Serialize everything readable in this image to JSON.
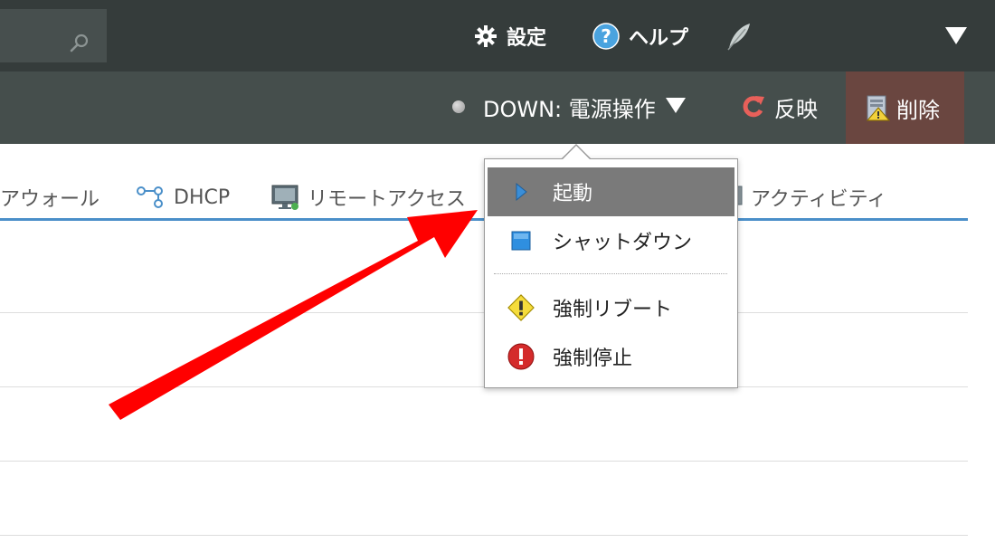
{
  "header": {
    "settings_label": "設定",
    "help_label": "ヘルプ"
  },
  "actions": {
    "power_status": "DOWN: 電源操作",
    "reflect_label": "反映",
    "delete_label": "削除"
  },
  "tabs": [
    {
      "label": "アウォール",
      "icon": "firewall-icon"
    },
    {
      "label": "DHCP",
      "icon": "network-nodes-icon"
    },
    {
      "label": "リモートアクセス",
      "icon": "monitor-icon"
    },
    {
      "label": "アクティビティ",
      "icon": "monitor-icon"
    }
  ],
  "power_menu": {
    "items": [
      {
        "label": "起動",
        "icon": "play-triangle-icon",
        "active": true
      },
      {
        "label": "シャットダウン",
        "icon": "blue-square-icon"
      },
      {
        "label": "強制リブート",
        "icon": "warning-diamond-icon"
      },
      {
        "label": "強制停止",
        "icon": "error-circle-icon"
      }
    ]
  },
  "colors": {
    "topbar": "#353c3b",
    "actionbar": "#454e4c",
    "delete_bg": "#6a4640",
    "tab_underline": "#4a8fc9",
    "menu_active": "#7a7a7a",
    "annotation": "#ff0000"
  }
}
